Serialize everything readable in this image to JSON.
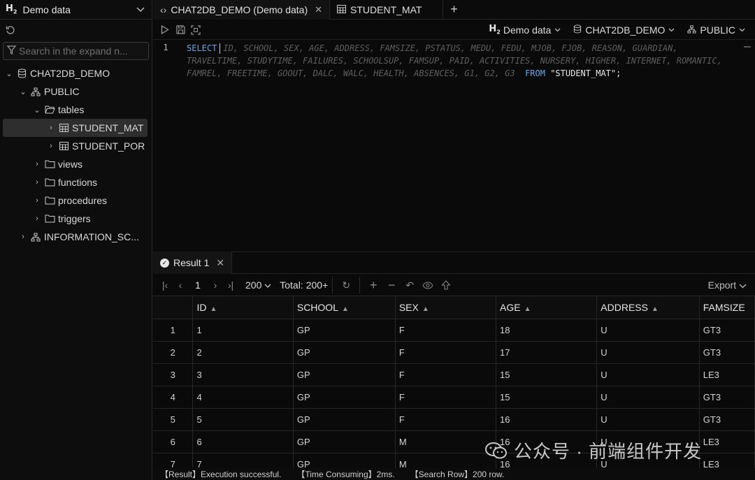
{
  "sidebar": {
    "brand": "H",
    "brand_sub": "2",
    "title": "Demo data",
    "search_placeholder": "Search in the expand n...",
    "tree": [
      {
        "label": "CHAT2DB_DEMO"
      },
      {
        "label": "PUBLIC"
      },
      {
        "label": "tables"
      },
      {
        "label": "STUDENT_MAT"
      },
      {
        "label": "STUDENT_POR"
      },
      {
        "label": "views"
      },
      {
        "label": "functions"
      },
      {
        "label": "procedures"
      },
      {
        "label": "triggers"
      },
      {
        "label": "INFORMATION_SC..."
      }
    ]
  },
  "tabs": [
    {
      "label": "CHAT2DB_DEMO (Demo data)"
    },
    {
      "label": "STUDENT_MAT"
    }
  ],
  "editor_toolbar": {
    "datasource": "Demo data",
    "database": "CHAT2DB_DEMO",
    "schema": "PUBLIC"
  },
  "editor": {
    "line_number": "1",
    "select_kw": "SELECT",
    "line1_cols": "ID, SCHOOL, SEX, AGE, ADDRESS, FAMSIZE, PSTATUS, MEDU, FEDU, MJOB, FJOB, REASON, GUARDIAN,",
    "line2_cols": "TRAVELTIME, STUDYTIME, FAILURES, SCHOOLSUP, FAMSUP, PAID, ACTIVITIES, NURSERY, HIGHER, INTERNET, ROMANTIC,",
    "line3_cols": "FAMREL, FREETIME, GOOUT, DALC, WALC, HEALTH, ABSENCES, G1, G2, G3",
    "from_kw": "FROM",
    "table_str": "\"STUDENT_MAT\";"
  },
  "result": {
    "tab_label": "Result 1",
    "page": "1",
    "page_size": "200",
    "total_label": "Total:",
    "total_value": "200+",
    "export_label": "Export",
    "columns": [
      "ID",
      "SCHOOL",
      "SEX",
      "AGE",
      "ADDRESS",
      "FAMSIZE"
    ],
    "rows": [
      [
        "1",
        "1",
        "GP",
        "F",
        "18",
        "U",
        "GT3"
      ],
      [
        "2",
        "2",
        "GP",
        "F",
        "17",
        "U",
        "GT3"
      ],
      [
        "3",
        "3",
        "GP",
        "F",
        "15",
        "U",
        "LE3"
      ],
      [
        "4",
        "4",
        "GP",
        "F",
        "15",
        "U",
        "GT3"
      ],
      [
        "5",
        "5",
        "GP",
        "F",
        "16",
        "U",
        "GT3"
      ],
      [
        "6",
        "6",
        "GP",
        "M",
        "16",
        "U",
        "LE3"
      ],
      [
        "7",
        "7",
        "GP",
        "M",
        "16",
        "U",
        "LE3"
      ]
    ]
  },
  "status": {
    "result": "【Result】Execution successful.",
    "time": "【Time Consuming】2ms.",
    "search_row": "【Search Row】200 row."
  },
  "watermark": "公众号 · 前端组件开发"
}
